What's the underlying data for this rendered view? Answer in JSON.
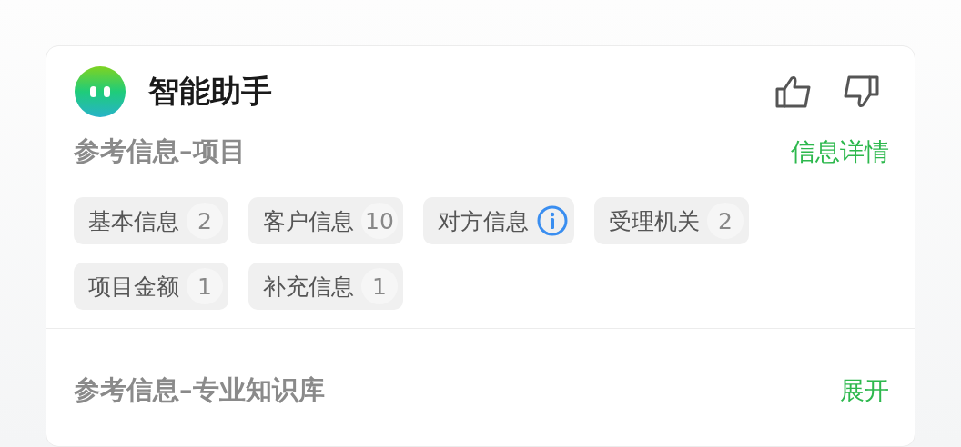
{
  "header": {
    "title": "智能助手"
  },
  "sections": [
    {
      "title": "参考信息–项目",
      "action": "信息详情",
      "tags": [
        {
          "kind": "count",
          "label": "基本信息",
          "count": "2"
        },
        {
          "kind": "count",
          "label": "客户信息",
          "count": "10"
        },
        {
          "kind": "info",
          "label": "对方信息"
        },
        {
          "kind": "count",
          "label": "受理机关",
          "count": "2"
        },
        {
          "kind": "count",
          "label": "项目金额",
          "count": "1"
        },
        {
          "kind": "count",
          "label": "补充信息",
          "count": "1"
        }
      ]
    },
    {
      "title": "参考信息–专业知识库",
      "action": "展开"
    }
  ]
}
